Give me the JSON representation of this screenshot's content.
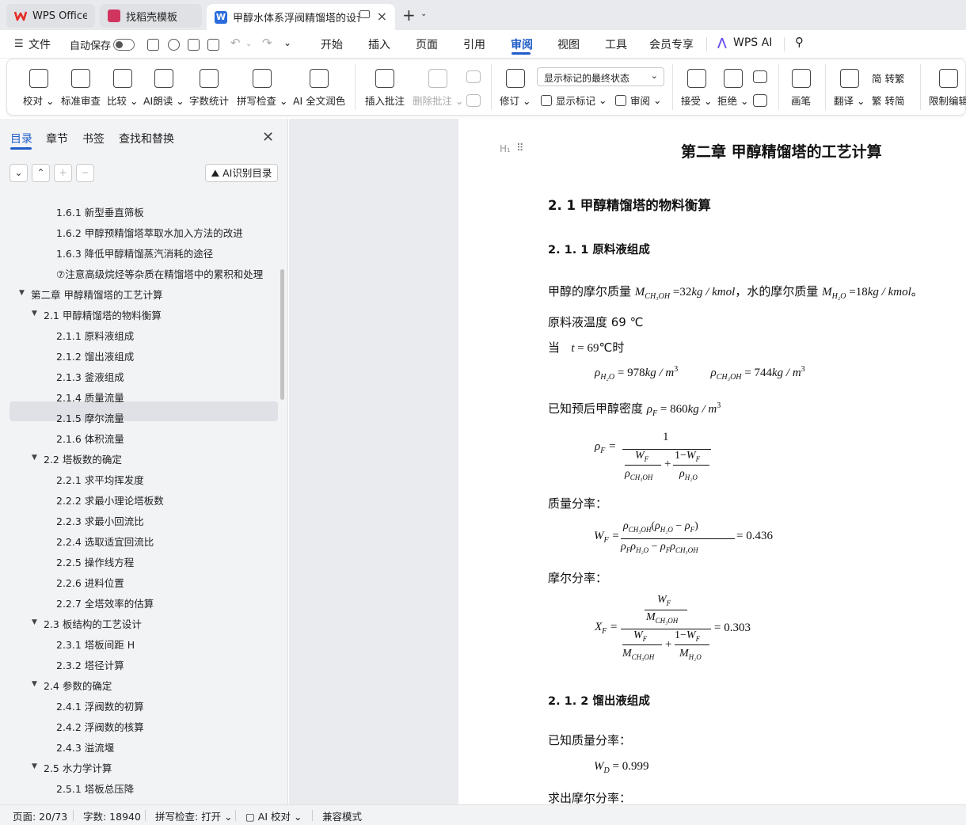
{
  "tabs": [
    {
      "label": "WPS Office"
    },
    {
      "label": "找稻壳模板"
    },
    {
      "label": "甲醇水体系浮阀精馏塔的设计"
    }
  ],
  "colors": {
    "accent": "#1f5dc8",
    "wps_red": "#e52d27",
    "docer_pink": "#d0355f",
    "word_blue": "#2b6cdc"
  },
  "menu": {
    "file": "文件",
    "autosave": "自动保存",
    "items": [
      "开始",
      "插入",
      "页面",
      "引用",
      "审阅",
      "视图",
      "工具",
      "会员专享"
    ],
    "active": "审阅",
    "wps_ai": "WPS AI"
  },
  "ribbon": {
    "proofread": "校对",
    "standard_review": "标准审查",
    "compare": "比较",
    "ai_read": "AI朗读",
    "word_count": "字数统计",
    "spell_check": "拼写检查",
    "ai_polish": "AI 全文润色",
    "insert_comment": "插入批注",
    "delete_comment": "删除批注",
    "track": "修订",
    "markup_dropdown": "显示标记的最终状态",
    "show_markup": "显示标记",
    "review_pane": "审阅",
    "accept": "接受",
    "reject": "拒绝",
    "pen": "画笔",
    "translate": "翻译",
    "to_traditional": "简 转繁",
    "to_simplified": "繁 转简",
    "restrict": "限制编辑"
  },
  "sidebar": {
    "tabs": [
      "目录",
      "章节",
      "书签",
      "查找和替换"
    ],
    "ai_toc": "AI识别目录",
    "toc": [
      {
        "level": 3,
        "text": "1.6.1 新型垂直筛板"
      },
      {
        "level": 3,
        "text": "1.6.2  甲醇预精馏塔萃取水加入方法的改进"
      },
      {
        "level": 3,
        "text": "1.6.3  降低甲醇精馏蒸汽消耗的途径"
      },
      {
        "level": 3,
        "text": "⑦注意高级烷烃等杂质在精馏塔中的累积和处理"
      },
      {
        "level": 1,
        "text": "第二章  甲醇精馏塔的工艺计算"
      },
      {
        "level": 2,
        "text": "2.1 甲醇精馏塔的物料衡算"
      },
      {
        "level": 3,
        "text": "2.1.1 原料液组成"
      },
      {
        "level": 3,
        "text": "2.1.2 馏出液组成"
      },
      {
        "level": 3,
        "text": "2.1.3 釜液组成"
      },
      {
        "level": 3,
        "text": "2.1.4 质量流量"
      },
      {
        "level": 3,
        "text": "2.1.5 摩尔流量"
      },
      {
        "level": 3,
        "text": "2.1.6 体积流量"
      },
      {
        "level": 2,
        "text": "2.2 塔板数的确定"
      },
      {
        "level": 3,
        "text": "2.2.1 求平均挥发度"
      },
      {
        "level": 3,
        "text": "2.2.2 求最小理论塔板数"
      },
      {
        "level": 3,
        "text": "2.2.3 求最小回流比"
      },
      {
        "level": 3,
        "text": "2.2.4 选取适宜回流比"
      },
      {
        "level": 3,
        "text": "2.2.5 操作线方程"
      },
      {
        "level": 3,
        "text": "2.2.6 进料位置"
      },
      {
        "level": 3,
        "text": "2.2.7 全塔效率的估算"
      },
      {
        "level": 2,
        "text": "2.3 板结构的工艺设计"
      },
      {
        "level": 3,
        "text": "2.3.1 塔板间距 H"
      },
      {
        "level": 3,
        "text": "2.3.2 塔径计算"
      },
      {
        "level": 2,
        "text": "2.4 参数的确定"
      },
      {
        "level": 3,
        "text": "2.4.1 浮阀数的初算"
      },
      {
        "level": 3,
        "text": "2.4.2 浮阀数的核算"
      },
      {
        "level": 3,
        "text": "2.4.3 溢流堰"
      },
      {
        "level": 2,
        "text": "2.5 水力学计算"
      },
      {
        "level": 3,
        "text": "2.5.1    塔板总压降"
      }
    ]
  },
  "doc": {
    "chapter_title": "第二章  甲醇精馏塔的工艺计算",
    "sec_2_1": "2. 1 甲醇精馏塔的物料衡算",
    "sec_2_1_1": "2. 1. 1 原料液组成",
    "p1a": "甲醇的摩尔质量",
    "p1b": "，水的摩尔质量",
    "p2": "原料液温度 69 ℃",
    "p3": "当",
    "p3b": "时",
    "p4": "已知预后甲醇密度",
    "p5": "质量分率：",
    "p6": "摩尔分率：",
    "sec_2_1_2": "2. 1. 2 馏出液组成",
    "p7": "已知质量分率：",
    "p8": "求出摩尔分率：",
    "wf_value": "0.436",
    "xf_value": "0.303",
    "wd_value": "0.999"
  },
  "status": {
    "page": "页面: 20/73",
    "words": "字数: 18940",
    "spell": "拼写检查: 打开",
    "ai_proof": "AI 校对",
    "compat": "兼容模式"
  }
}
